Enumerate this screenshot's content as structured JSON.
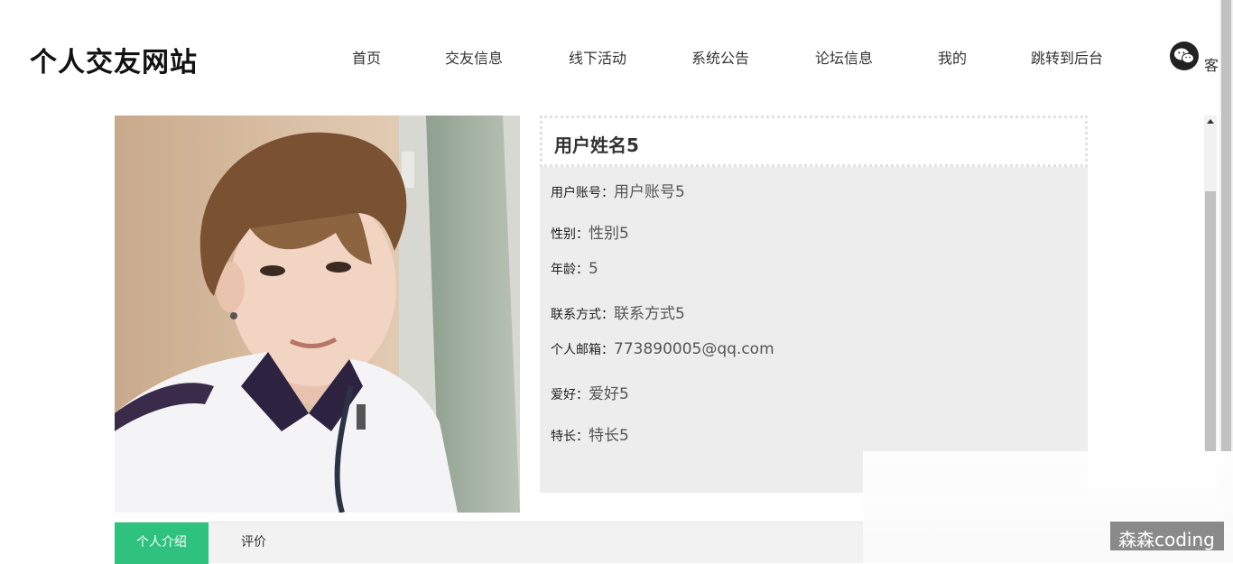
{
  "site": {
    "title": "个人交友网站"
  },
  "nav": {
    "items": [
      {
        "label": "首页"
      },
      {
        "label": "交友信息"
      },
      {
        "label": "线下活动"
      },
      {
        "label": "系统公告"
      },
      {
        "label": "论坛信息"
      },
      {
        "label": "我的"
      },
      {
        "label": "跳转到后台"
      }
    ],
    "service_label": "客"
  },
  "profile": {
    "name": "用户姓名5",
    "fields": [
      {
        "label": "用户账号：",
        "value": "用户账号5"
      },
      {
        "label": "性别：",
        "value": "性别5"
      },
      {
        "label": "年龄：",
        "value": "5"
      },
      {
        "label": "联系方式：",
        "value": "联系方式5"
      },
      {
        "label": "个人邮箱：",
        "value": "773890005@qq.com"
      },
      {
        "label": "爱好：",
        "value": "爱好5"
      },
      {
        "label": "特长：",
        "value": "特长5"
      }
    ]
  },
  "tabs": [
    {
      "label": "个人介绍",
      "active": true
    },
    {
      "label": "评价",
      "active": false
    }
  ],
  "watermark": "森森coding",
  "colors": {
    "accent": "#2ec27e",
    "panel_bg": "#ededed"
  },
  "icons": {
    "wechat": "wechat-icon",
    "scroll_up": "scroll-up-arrow-icon"
  }
}
